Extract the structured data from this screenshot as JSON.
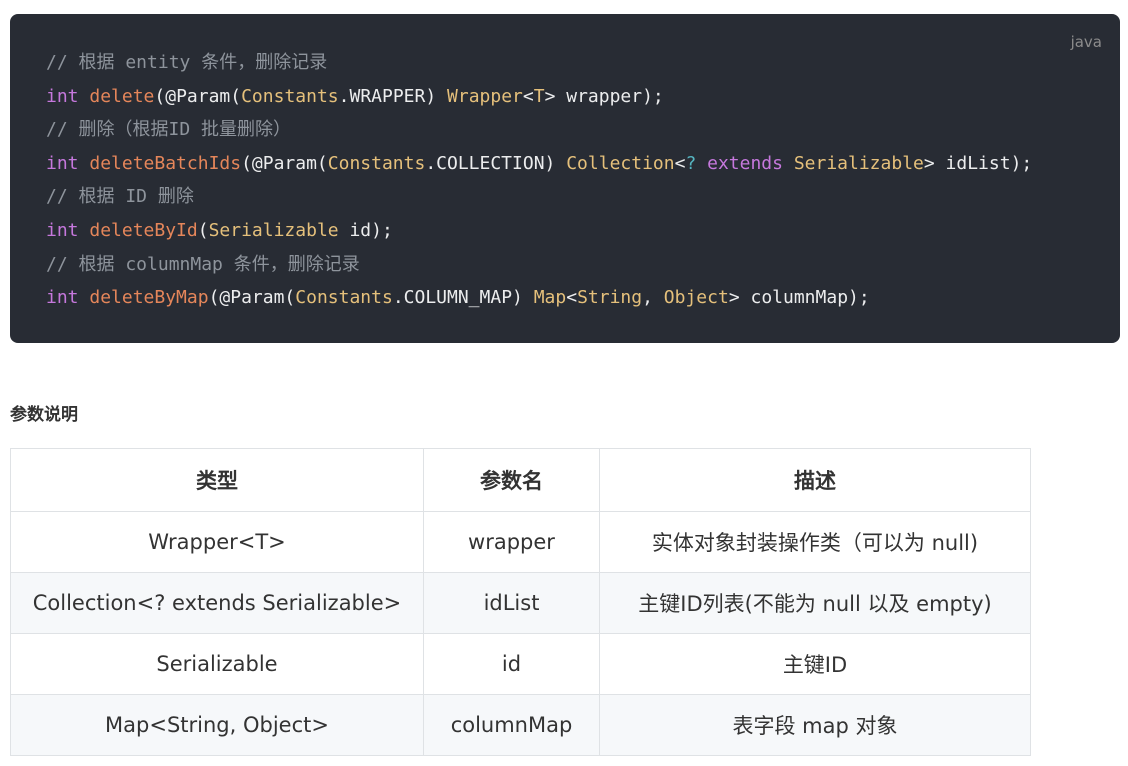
{
  "code": {
    "language": "java",
    "lines": [
      [
        {
          "t": "// 根据 entity 条件，删除记录",
          "c": "comment"
        }
      ],
      [
        {
          "t": "int",
          "c": "kw"
        },
        {
          "t": " ",
          "c": "plain"
        },
        {
          "t": "delete",
          "c": "fn"
        },
        {
          "t": "(@Param(",
          "c": "plain"
        },
        {
          "t": "Constants",
          "c": "type"
        },
        {
          "t": ".WRAPPER) ",
          "c": "plain"
        },
        {
          "t": "Wrapper",
          "c": "type"
        },
        {
          "t": "<",
          "c": "plain"
        },
        {
          "t": "T",
          "c": "type"
        },
        {
          "t": "> wrapper);",
          "c": "plain"
        }
      ],
      [
        {
          "t": "// 删除（根据ID 批量删除）",
          "c": "comment"
        }
      ],
      [
        {
          "t": "int",
          "c": "kw"
        },
        {
          "t": " ",
          "c": "plain"
        },
        {
          "t": "deleteBatchIds",
          "c": "fn"
        },
        {
          "t": "(@Param(",
          "c": "plain"
        },
        {
          "t": "Constants",
          "c": "type"
        },
        {
          "t": ".COLLECTION) ",
          "c": "plain"
        },
        {
          "t": "Collection",
          "c": "type"
        },
        {
          "t": "<",
          "c": "plain"
        },
        {
          "t": "?",
          "c": "op"
        },
        {
          "t": " ",
          "c": "plain"
        },
        {
          "t": "extends",
          "c": "kw"
        },
        {
          "t": " ",
          "c": "plain"
        },
        {
          "t": "Serializable",
          "c": "type"
        },
        {
          "t": "> idList);",
          "c": "plain"
        }
      ],
      [
        {
          "t": "// 根据 ID 删除",
          "c": "comment"
        }
      ],
      [
        {
          "t": "int",
          "c": "kw"
        },
        {
          "t": " ",
          "c": "plain"
        },
        {
          "t": "deleteById",
          "c": "fn"
        },
        {
          "t": "(",
          "c": "plain"
        },
        {
          "t": "Serializable",
          "c": "type"
        },
        {
          "t": " id);",
          "c": "plain"
        }
      ],
      [
        {
          "t": "// 根据 columnMap 条件，删除记录",
          "c": "comment"
        }
      ],
      [
        {
          "t": "int",
          "c": "kw"
        },
        {
          "t": " ",
          "c": "plain"
        },
        {
          "t": "deleteByMap",
          "c": "fn"
        },
        {
          "t": "(@Param(",
          "c": "plain"
        },
        {
          "t": "Constants",
          "c": "type"
        },
        {
          "t": ".COLUMN_MAP) ",
          "c": "plain"
        },
        {
          "t": "Map",
          "c": "type"
        },
        {
          "t": "<",
          "c": "plain"
        },
        {
          "t": "String",
          "c": "type"
        },
        {
          "t": ", ",
          "c": "plain"
        },
        {
          "t": "Object",
          "c": "type"
        },
        {
          "t": "> columnMap);",
          "c": "plain"
        }
      ]
    ]
  },
  "section_title": "参数说明",
  "table": {
    "headers": [
      "类型",
      "参数名",
      "描述"
    ],
    "rows": [
      [
        "Wrapper<T>",
        "wrapper",
        "实体对象封装操作类（可以为 null)"
      ],
      [
        "Collection<? extends Serializable>",
        "idList",
        "主键ID列表(不能为 null 以及 empty)"
      ],
      [
        "Serializable",
        "id",
        "主键ID"
      ],
      [
        "Map<String, Object>",
        "columnMap",
        "表字段 map 对象"
      ]
    ]
  }
}
